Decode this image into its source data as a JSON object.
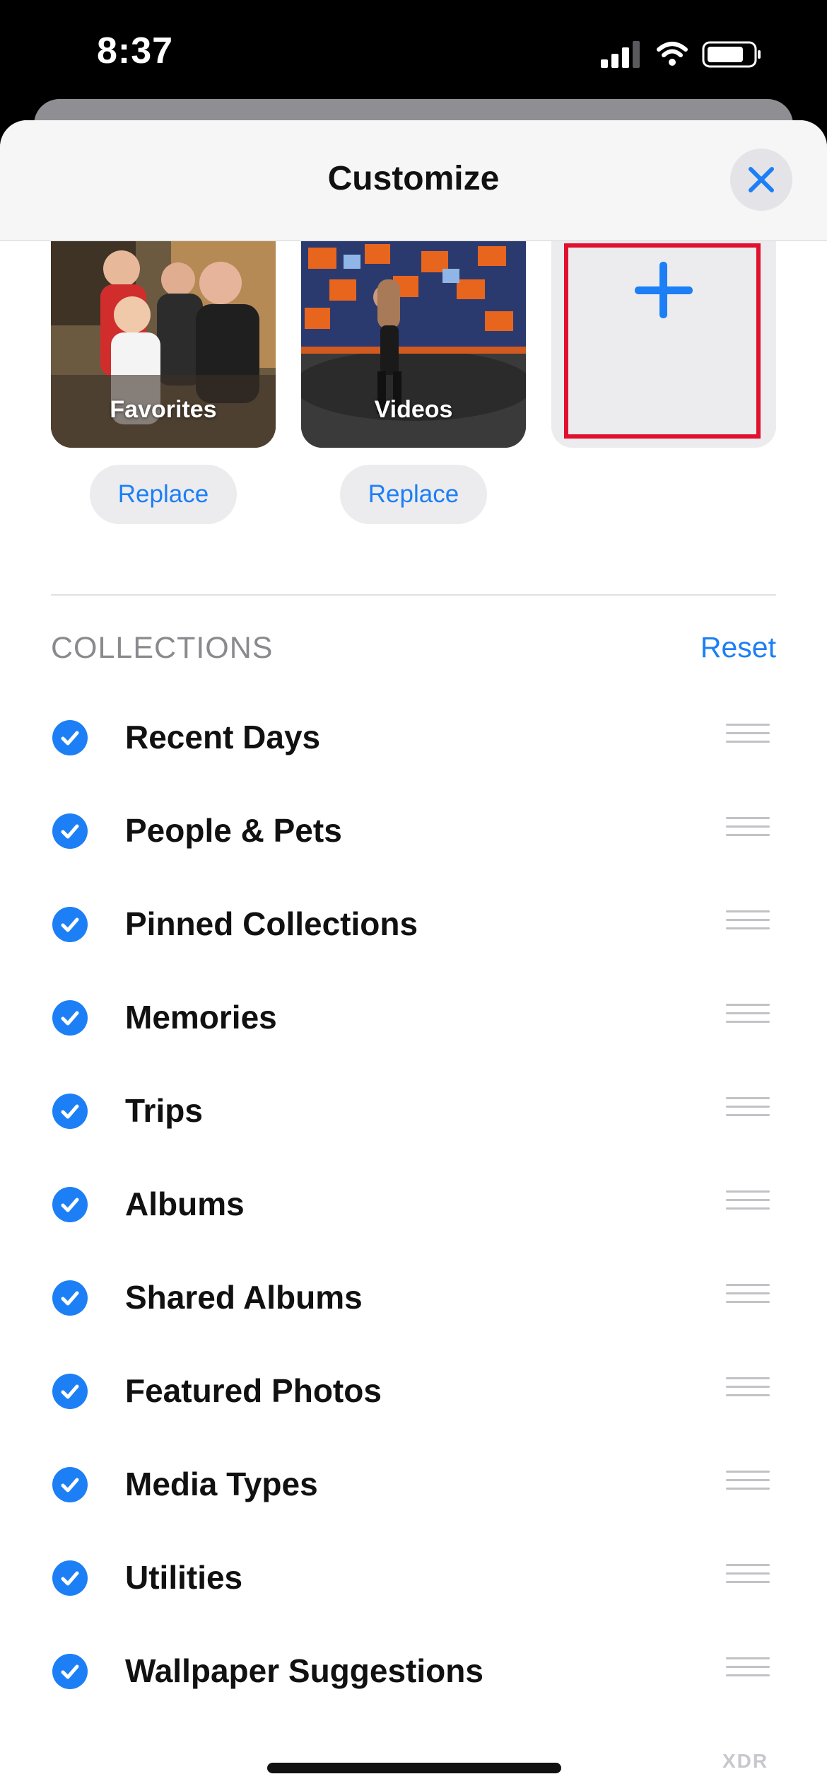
{
  "status": {
    "time": "8:37"
  },
  "header": {
    "title": "Customize"
  },
  "pinned": {
    "tiles": [
      {
        "label": "Favorites"
      },
      {
        "label": "Videos"
      }
    ],
    "replace_label": "Replace"
  },
  "collections": {
    "title": "COLLECTIONS",
    "reset_label": "Reset",
    "items": [
      {
        "label": "Recent Days",
        "checked": true
      },
      {
        "label": "People & Pets",
        "checked": true
      },
      {
        "label": "Pinned Collections",
        "checked": true
      },
      {
        "label": "Memories",
        "checked": true
      },
      {
        "label": "Trips",
        "checked": true
      },
      {
        "label": "Albums",
        "checked": true
      },
      {
        "label": "Shared Albums",
        "checked": true
      },
      {
        "label": "Featured Photos",
        "checked": true
      },
      {
        "label": "Media Types",
        "checked": true
      },
      {
        "label": "Utilities",
        "checked": true
      },
      {
        "label": "Wallpaper Suggestions",
        "checked": true
      }
    ]
  },
  "watermark": "XDR",
  "colors": {
    "accent": "#1d7ff5",
    "highlight": "#e0102e"
  }
}
